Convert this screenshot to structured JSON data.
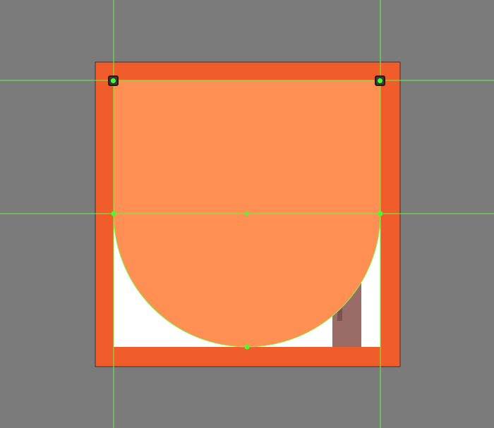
{
  "canvas": {
    "background": "#7b7b7b"
  },
  "artwork": {
    "frame": {
      "fill": "#f15d2a",
      "stroke": "#333333"
    },
    "inner_background": {
      "fill": "#ffffff"
    },
    "trunk": {
      "fill": "#9a6b67",
      "shadow_fill": "#7a524f"
    },
    "canopy": {
      "fill": "#ff8f52",
      "outline": "#7cfc4a"
    }
  },
  "guides": {
    "color": "#5cff3a",
    "vertical": [
      "guide-left",
      "guide-right"
    ],
    "horizontal": [
      "guide-top",
      "guide-middle"
    ]
  },
  "anchors": {
    "fill": "#45ff2f",
    "selected_frame": "#3a3a3a",
    "points": [
      "corner-top-left",
      "corner-top-right",
      "mid-left",
      "mid-center",
      "mid-right",
      "bottom-center"
    ]
  }
}
